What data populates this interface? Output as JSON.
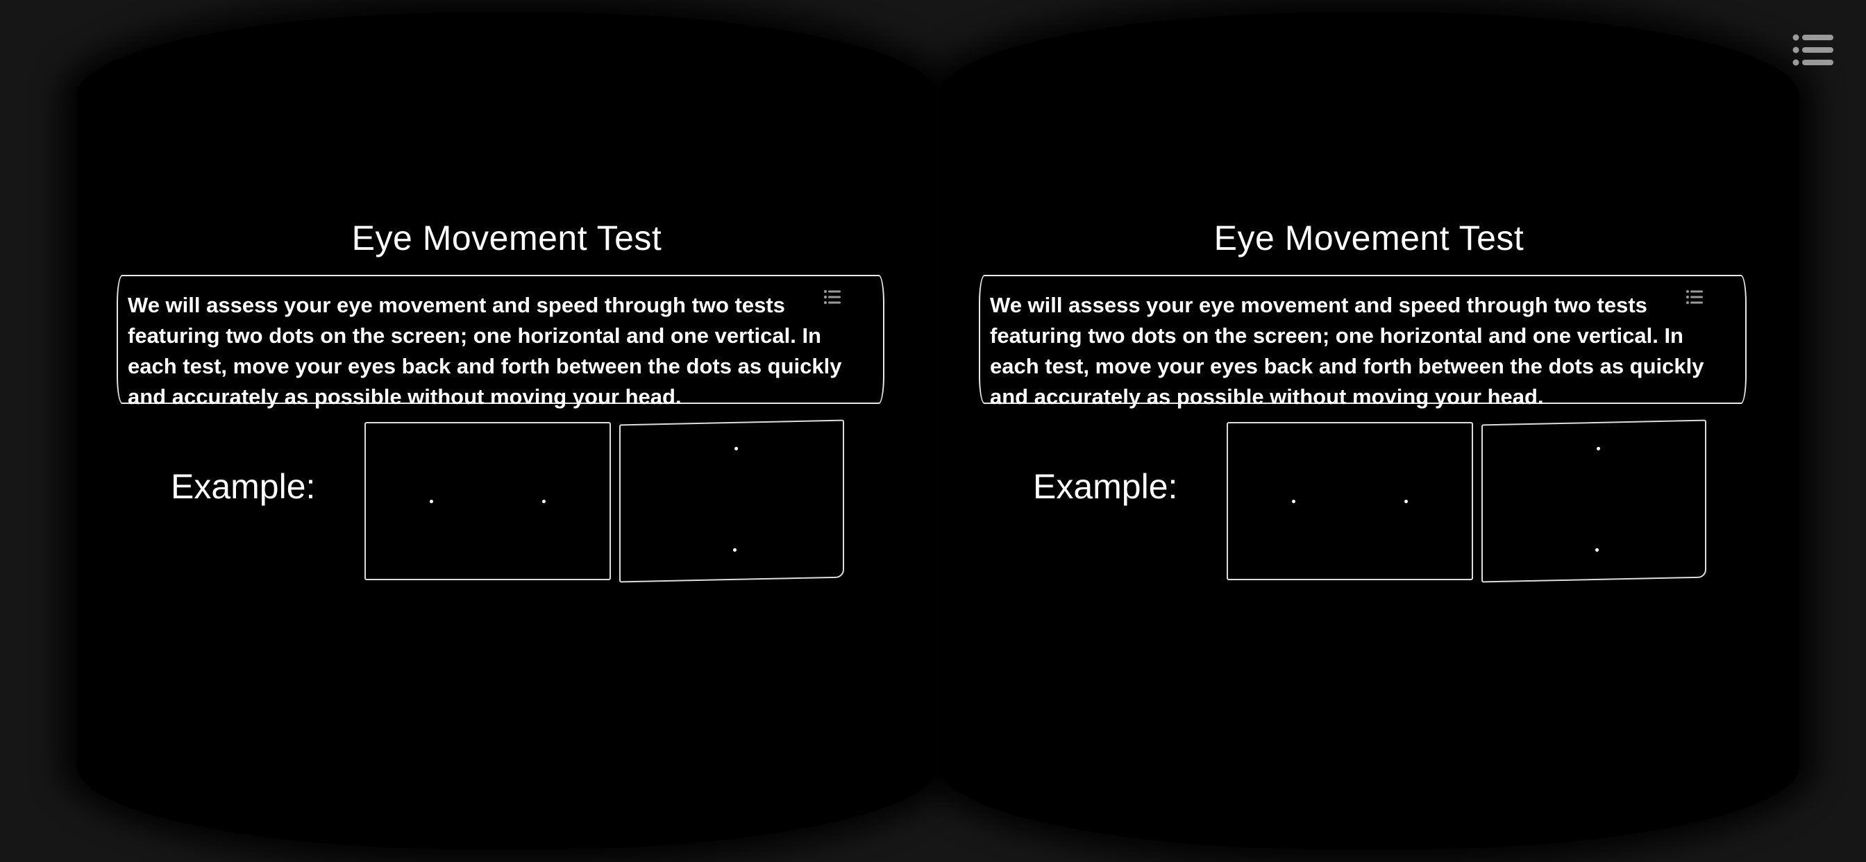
{
  "screen": {
    "title": "Eye Movement Test",
    "description": "We will assess your eye movement and speed through two tests featuring two dots on the screen; one horizontal and one vertical. In each test, move your eyes back and forth between the dots as quickly and accurately as possible without moving your head.",
    "example_label": "Example:"
  },
  "icons": {
    "top_right": "list-menu-icon",
    "panel_corner": "list-menu-icon"
  },
  "colors": {
    "background": "#161616",
    "viewport": "#000000",
    "text": "#ffffff",
    "icon": "#9a9a9a"
  }
}
